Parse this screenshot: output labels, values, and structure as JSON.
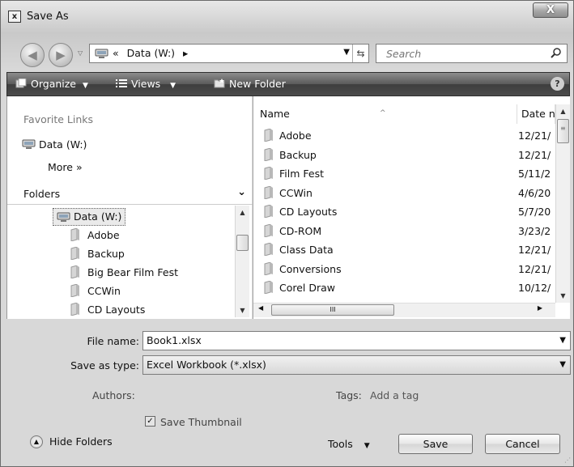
{
  "window": {
    "title": "Save As",
    "close_label": "X",
    "title_icon": "save-as-dialog-icon"
  },
  "address": {
    "prefix": "«",
    "location": "Data (W:)",
    "suffix": "▸",
    "icon": "computer-drive-icon"
  },
  "search": {
    "placeholder": "Search"
  },
  "toolbar": {
    "organize": "Organize",
    "views": "Views",
    "new_folder": "New Folder",
    "help": "?"
  },
  "favorites": {
    "heading": "Favorite Links",
    "items": [
      {
        "label": "Data (W:)"
      }
    ],
    "more": "More »"
  },
  "folders": {
    "label": "Folders",
    "tree": [
      {
        "label": "Data (W:)"
      },
      {
        "label": "Adobe"
      },
      {
        "label": "Backup"
      },
      {
        "label": "Big Bear Film Fest"
      },
      {
        "label": "CCWin"
      },
      {
        "label": "CD Layouts"
      }
    ]
  },
  "file_list": {
    "columns": [
      "Name",
      "Date n"
    ],
    "rows": [
      {
        "name": "Adobe",
        "date": "12/21/"
      },
      {
        "name": "Backup",
        "date": "12/21/"
      },
      {
        "name": "Film Fest",
        "date": "5/11/2"
      },
      {
        "name": "CCWin",
        "date": "4/6/20"
      },
      {
        "name": "CD Layouts",
        "date": "5/7/20"
      },
      {
        "name": "CD-ROM",
        "date": "3/23/2"
      },
      {
        "name": "Class Data",
        "date": "12/21/"
      },
      {
        "name": "Conversions",
        "date": "12/21/"
      },
      {
        "name": "Corel Draw",
        "date": "10/12/"
      }
    ],
    "hscroll_grip": "III"
  },
  "form": {
    "file_name_label": "File name:",
    "file_name_value": "Book1.xlsx",
    "save_type_label": "Save as type:",
    "save_type_value": "Excel Workbook (*.xlsx)",
    "authors_label": "Authors:",
    "tags_label": "Tags:",
    "tags_value": "Add a tag",
    "thumbnail_label": "Save Thumbnail",
    "thumbnail_checked": true
  },
  "footer": {
    "hide_folders": "Hide Folders",
    "tools": "Tools",
    "save": "Save",
    "cancel": "Cancel"
  }
}
